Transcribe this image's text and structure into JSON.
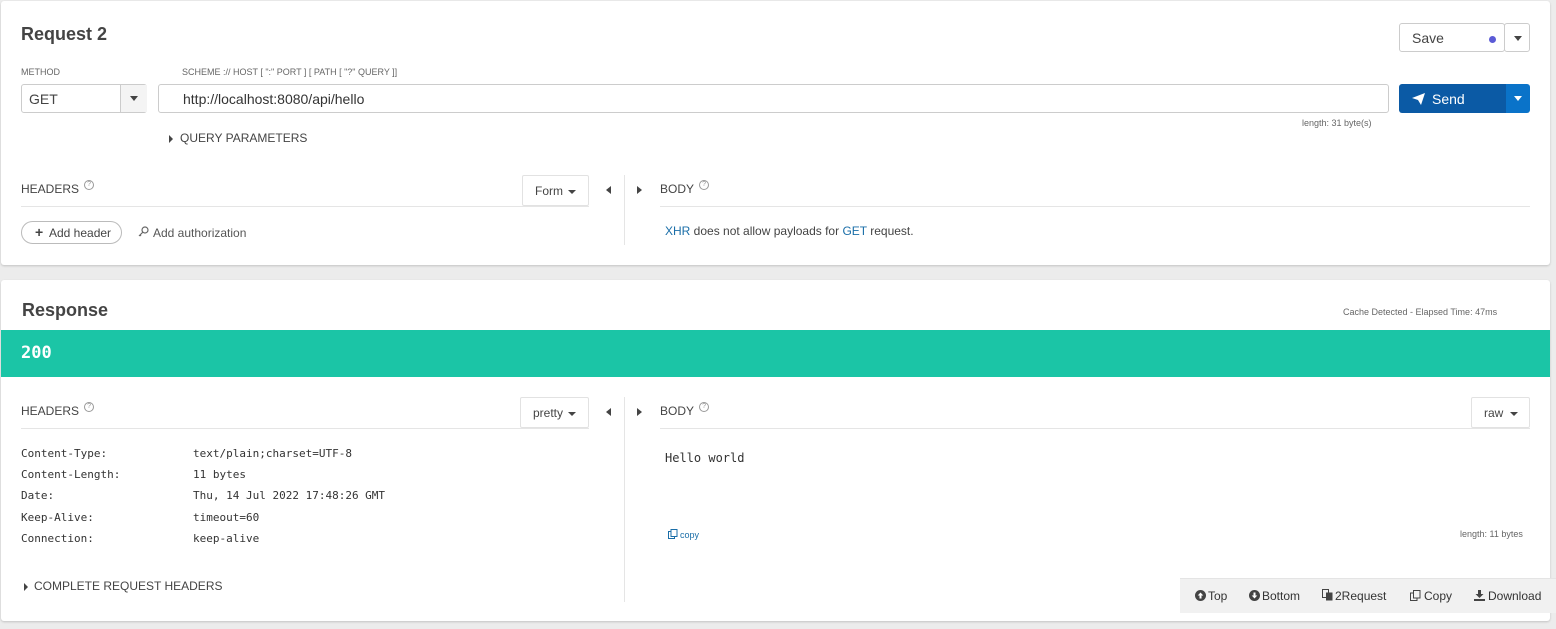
{
  "request": {
    "title": "Request 2",
    "save_label": "Save",
    "method_label": "METHOD",
    "method_value": "GET",
    "url_label": "SCHEME :// HOST [ \":\" PORT ] [ PATH [ \"?\" QUERY ]]",
    "url_value": "http://localhost:8080/api/hello",
    "url_length": "length: 31 byte(s)",
    "send_label": "Send",
    "query_params_label": "QUERY PARAMETERS",
    "headers_label": "HEADERS",
    "headers_mode": "Form",
    "add_header_label": "Add header",
    "add_auth_label": "Add authorization",
    "body_label": "BODY",
    "body_message": {
      "xhr": "XHR",
      "middle": " does not allow payloads for ",
      "method": "GET",
      "end": " request."
    }
  },
  "response": {
    "title": "Response",
    "cache_info": "Cache Detected - Elapsed Time: 47ms",
    "status_code": "200",
    "status_color": "#1bc5a6",
    "headers_label": "HEADERS",
    "headers_mode": "pretty",
    "headers": [
      {
        "key": "Content-Type:",
        "value": "text/plain;charset=UTF-8"
      },
      {
        "key": "Content-Length:",
        "value": "11 bytes"
      },
      {
        "key": "Date:",
        "value": "Thu, 14 Jul 2022 17:48:26 GMT"
      },
      {
        "key": "Keep-Alive:",
        "value": "timeout=60"
      },
      {
        "key": "Connection:",
        "value": "keep-alive"
      }
    ],
    "complete_headers_label": "COMPLETE REQUEST HEADERS",
    "body_label": "BODY",
    "body_mode": "raw",
    "body_text": "Hello world",
    "copy_label": "copy",
    "body_length": "length: 11 bytes"
  },
  "action_bar": {
    "top": "Top",
    "bottom": "Bottom",
    "to_request": "2Request",
    "copy": "Copy",
    "download": "Download"
  },
  "colors": {
    "accent_blue": "#0b5aa5",
    "link_blue": "#1a6ea8",
    "save_dot": "#5b5bd6"
  }
}
